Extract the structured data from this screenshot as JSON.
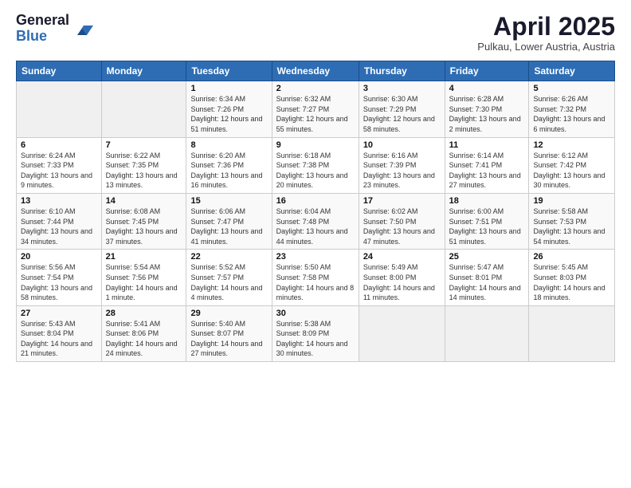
{
  "logo": {
    "general": "General",
    "blue": "Blue"
  },
  "header": {
    "title": "April 2025",
    "subtitle": "Pulkau, Lower Austria, Austria"
  },
  "weekdays": [
    "Sunday",
    "Monday",
    "Tuesday",
    "Wednesday",
    "Thursday",
    "Friday",
    "Saturday"
  ],
  "weeks": [
    [
      {
        "day": "",
        "info": ""
      },
      {
        "day": "",
        "info": ""
      },
      {
        "day": "1",
        "info": "Sunrise: 6:34 AM\nSunset: 7:26 PM\nDaylight: 12 hours and 51 minutes."
      },
      {
        "day": "2",
        "info": "Sunrise: 6:32 AM\nSunset: 7:27 PM\nDaylight: 12 hours and 55 minutes."
      },
      {
        "day": "3",
        "info": "Sunrise: 6:30 AM\nSunset: 7:29 PM\nDaylight: 12 hours and 58 minutes."
      },
      {
        "day": "4",
        "info": "Sunrise: 6:28 AM\nSunset: 7:30 PM\nDaylight: 13 hours and 2 minutes."
      },
      {
        "day": "5",
        "info": "Sunrise: 6:26 AM\nSunset: 7:32 PM\nDaylight: 13 hours and 6 minutes."
      }
    ],
    [
      {
        "day": "6",
        "info": "Sunrise: 6:24 AM\nSunset: 7:33 PM\nDaylight: 13 hours and 9 minutes."
      },
      {
        "day": "7",
        "info": "Sunrise: 6:22 AM\nSunset: 7:35 PM\nDaylight: 13 hours and 13 minutes."
      },
      {
        "day": "8",
        "info": "Sunrise: 6:20 AM\nSunset: 7:36 PM\nDaylight: 13 hours and 16 minutes."
      },
      {
        "day": "9",
        "info": "Sunrise: 6:18 AM\nSunset: 7:38 PM\nDaylight: 13 hours and 20 minutes."
      },
      {
        "day": "10",
        "info": "Sunrise: 6:16 AM\nSunset: 7:39 PM\nDaylight: 13 hours and 23 minutes."
      },
      {
        "day": "11",
        "info": "Sunrise: 6:14 AM\nSunset: 7:41 PM\nDaylight: 13 hours and 27 minutes."
      },
      {
        "day": "12",
        "info": "Sunrise: 6:12 AM\nSunset: 7:42 PM\nDaylight: 13 hours and 30 minutes."
      }
    ],
    [
      {
        "day": "13",
        "info": "Sunrise: 6:10 AM\nSunset: 7:44 PM\nDaylight: 13 hours and 34 minutes."
      },
      {
        "day": "14",
        "info": "Sunrise: 6:08 AM\nSunset: 7:45 PM\nDaylight: 13 hours and 37 minutes."
      },
      {
        "day": "15",
        "info": "Sunrise: 6:06 AM\nSunset: 7:47 PM\nDaylight: 13 hours and 41 minutes."
      },
      {
        "day": "16",
        "info": "Sunrise: 6:04 AM\nSunset: 7:48 PM\nDaylight: 13 hours and 44 minutes."
      },
      {
        "day": "17",
        "info": "Sunrise: 6:02 AM\nSunset: 7:50 PM\nDaylight: 13 hours and 47 minutes."
      },
      {
        "day": "18",
        "info": "Sunrise: 6:00 AM\nSunset: 7:51 PM\nDaylight: 13 hours and 51 minutes."
      },
      {
        "day": "19",
        "info": "Sunrise: 5:58 AM\nSunset: 7:53 PM\nDaylight: 13 hours and 54 minutes."
      }
    ],
    [
      {
        "day": "20",
        "info": "Sunrise: 5:56 AM\nSunset: 7:54 PM\nDaylight: 13 hours and 58 minutes."
      },
      {
        "day": "21",
        "info": "Sunrise: 5:54 AM\nSunset: 7:56 PM\nDaylight: 14 hours and 1 minute."
      },
      {
        "day": "22",
        "info": "Sunrise: 5:52 AM\nSunset: 7:57 PM\nDaylight: 14 hours and 4 minutes."
      },
      {
        "day": "23",
        "info": "Sunrise: 5:50 AM\nSunset: 7:58 PM\nDaylight: 14 hours and 8 minutes."
      },
      {
        "day": "24",
        "info": "Sunrise: 5:49 AM\nSunset: 8:00 PM\nDaylight: 14 hours and 11 minutes."
      },
      {
        "day": "25",
        "info": "Sunrise: 5:47 AM\nSunset: 8:01 PM\nDaylight: 14 hours and 14 minutes."
      },
      {
        "day": "26",
        "info": "Sunrise: 5:45 AM\nSunset: 8:03 PM\nDaylight: 14 hours and 18 minutes."
      }
    ],
    [
      {
        "day": "27",
        "info": "Sunrise: 5:43 AM\nSunset: 8:04 PM\nDaylight: 14 hours and 21 minutes."
      },
      {
        "day": "28",
        "info": "Sunrise: 5:41 AM\nSunset: 8:06 PM\nDaylight: 14 hours and 24 minutes."
      },
      {
        "day": "29",
        "info": "Sunrise: 5:40 AM\nSunset: 8:07 PM\nDaylight: 14 hours and 27 minutes."
      },
      {
        "day": "30",
        "info": "Sunrise: 5:38 AM\nSunset: 8:09 PM\nDaylight: 14 hours and 30 minutes."
      },
      {
        "day": "",
        "info": ""
      },
      {
        "day": "",
        "info": ""
      },
      {
        "day": "",
        "info": ""
      }
    ]
  ]
}
